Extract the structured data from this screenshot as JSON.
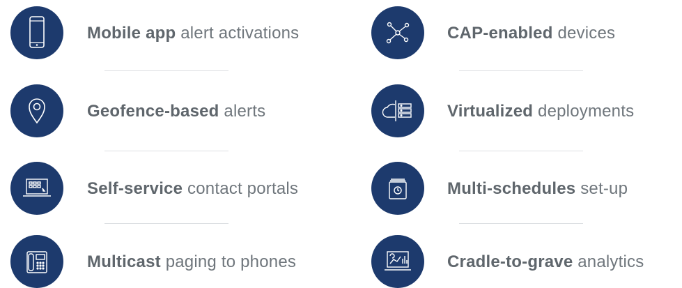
{
  "features": [
    {
      "bold": "Mobile app",
      "rest": "alert activations",
      "icon": "mobile-phone-icon"
    },
    {
      "bold": "CAP-enabled",
      "rest": "devices",
      "icon": "network-nodes-icon"
    },
    {
      "bold": "Geofence-based",
      "rest": "alerts",
      "icon": "location-pin-icon"
    },
    {
      "bold": "Virtualized",
      "rest": "deployments",
      "icon": "cloud-server-icon"
    },
    {
      "bold": "Self-service",
      "rest": "contact portals",
      "icon": "laptop-portal-icon"
    },
    {
      "bold": "Multi-schedules",
      "rest": "set-up",
      "icon": "calendar-clock-icon"
    },
    {
      "bold": "Multicast",
      "rest": "paging to phones",
      "icon": "desk-phone-icon"
    },
    {
      "bold": "Cradle-to-grave",
      "rest": "analytics",
      "icon": "analytics-monitor-icon"
    }
  ],
  "colors": {
    "circle": "#1d3a6d",
    "text": "#6f767c",
    "divider": "#dde0e3"
  }
}
